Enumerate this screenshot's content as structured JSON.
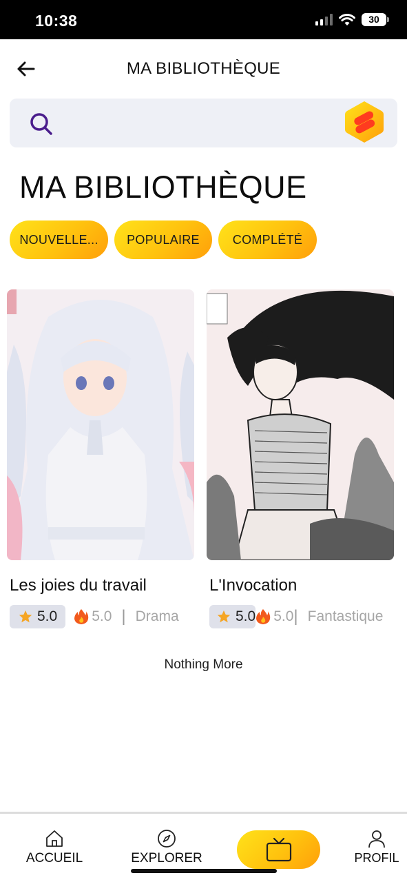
{
  "status_bar": {
    "time": "10:38",
    "battery": "30"
  },
  "header": {
    "title": "MA BIBLIOTHÈQUE",
    "back_icon": "arrow-left-icon"
  },
  "search": {
    "placeholder": "",
    "icon": "search-icon",
    "logo": "app-logo-icon"
  },
  "page_title": "MA BIBLIOTHÈQUE",
  "filters": [
    {
      "label": "NOUVELLE..."
    },
    {
      "label": "POPULAIRE"
    },
    {
      "label": "COMPLÉTÉ"
    }
  ],
  "books": [
    {
      "title": "Les joies du travail",
      "rating": "5.0",
      "heat": "5.0",
      "genre": "Drama"
    },
    {
      "title": "L'Invocation",
      "rating": "5.0",
      "heat": "5.0",
      "genre": "Fantastique"
    }
  ],
  "footer_text": "Nothing More",
  "nav": {
    "accueil": "ACCUEIL",
    "explorer": "EXPLORER",
    "profil": "PROFIL"
  },
  "colors": {
    "accent": "#ffc20e",
    "accent_end": "#ff9f0a",
    "search_bg": "#eef0f6",
    "pill_bg": "#dfe1ea",
    "search_icon": "#4a1d8c"
  }
}
